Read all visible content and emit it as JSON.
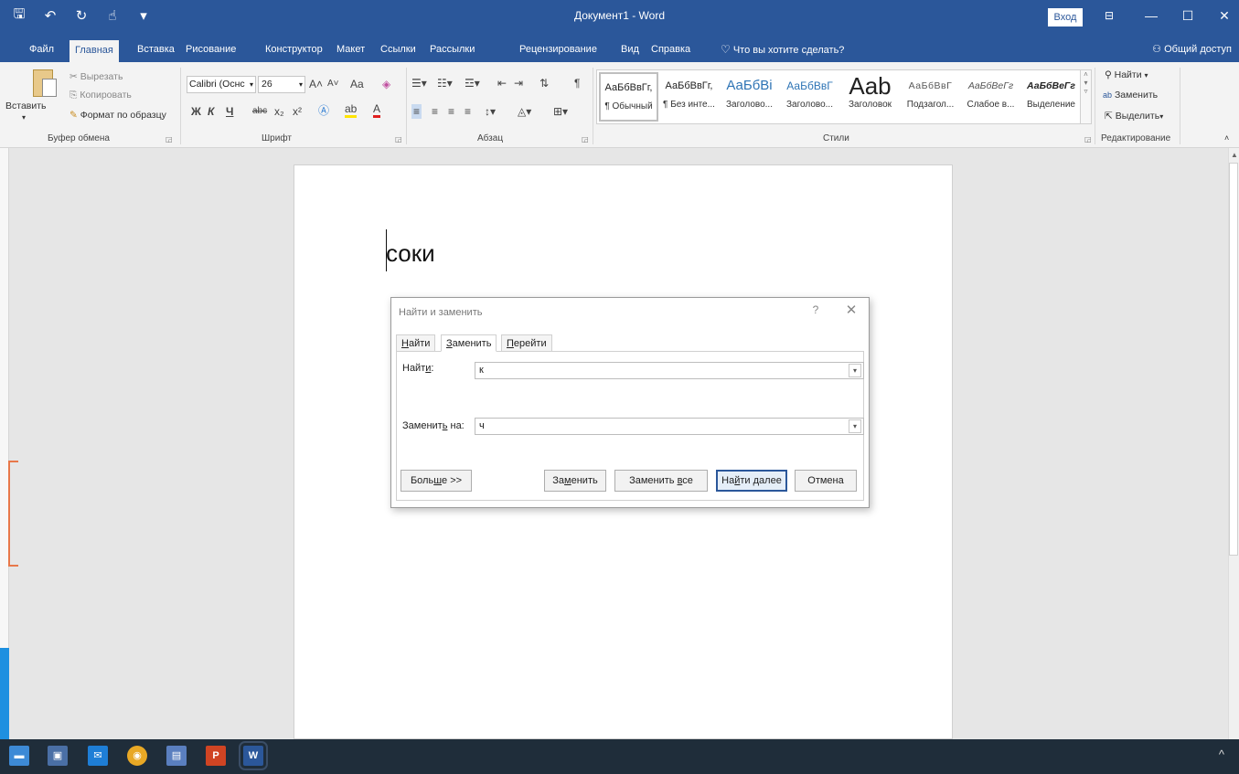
{
  "window": {
    "title": "Документ1 - Word",
    "signin": "Вход",
    "min": "—",
    "max": "☐",
    "close": "✕"
  },
  "qat": {
    "save": "🖫",
    "undo": "↶",
    "redo": "↻",
    "touch": "☝",
    "more": "▾"
  },
  "tabs": [
    "Файл",
    "Главная",
    "Вставка",
    "Рисование",
    "Конструктор",
    "Макет",
    "Ссылки",
    "Рассылки",
    "Рецензирование",
    "Вид",
    "Справка"
  ],
  "tellme": "Что вы хотите сделать?",
  "share": "Общий доступ",
  "clipboard": {
    "paste": "Вставить",
    "cut": "Вырезать",
    "copy": "Копировать",
    "format_painter": "Формат по образцу",
    "label": "Буфер обмена"
  },
  "font": {
    "name": "Calibri (Оснс",
    "size": "26",
    "label": "Шрифт",
    "bold": "Ж",
    "italic": "К",
    "underline": "Ч",
    "strike": "abc",
    "sub": "x₂",
    "sup": "x²",
    "grow": "A˄",
    "shrink": "A˅",
    "case": "Aa"
  },
  "paragraph": {
    "label": "Абзац",
    "pilcrow": "¶"
  },
  "styles": {
    "label": "Стили",
    "items": [
      {
        "preview": "АаБбВвГг,",
        "name": "¶ Обычный"
      },
      {
        "preview": "АаБбВвГг,",
        "name": "¶ Без инте..."
      },
      {
        "preview": "АаБбВі",
        "name": "Заголово..."
      },
      {
        "preview": "АаБбВвГ",
        "name": "Заголово..."
      },
      {
        "preview": "Aab",
        "name": "Заголовок"
      },
      {
        "preview": "АаБбВвГ",
        "name": "Подзагол..."
      },
      {
        "preview": "АаБбВеГг",
        "name": "Слабое в..."
      },
      {
        "preview": "АаБбВеГг",
        "name": "Выделение"
      }
    ]
  },
  "editing": {
    "find": "Найти",
    "replace": "Заменить",
    "select": "Выделить",
    "label": "Редактирование"
  },
  "document": {
    "text": "соки"
  },
  "dialog": {
    "title": "Найти и заменить",
    "help": "?",
    "close": "✕",
    "tabs": {
      "find": {
        "pre": "",
        "u": "Н",
        "post": "айти"
      },
      "replace": {
        "pre": "",
        "u": "З",
        "post": "аменить"
      },
      "goto": {
        "pre": "",
        "u": "П",
        "post": "ерейти"
      }
    },
    "find_label": {
      "pre": "Найт",
      "u": "и",
      "post": ":"
    },
    "find_value": "к",
    "replace_label": {
      "pre": "Заменит",
      "u": "ь",
      "post": " на:"
    },
    "replace_value": "ч",
    "more": {
      "pre": "Боль",
      "u": "ш",
      "post": "е >>"
    },
    "replace_btn": {
      "pre": "За",
      "u": "м",
      "post": "енить"
    },
    "replace_all": {
      "pre": "Заменить ",
      "u": "в",
      "post": "се"
    },
    "find_next": {
      "pre": "На",
      "u": "й",
      "post": "ти далее"
    },
    "cancel": "Отмена"
  },
  "taskbar": {
    "tray_arrow": "^"
  }
}
